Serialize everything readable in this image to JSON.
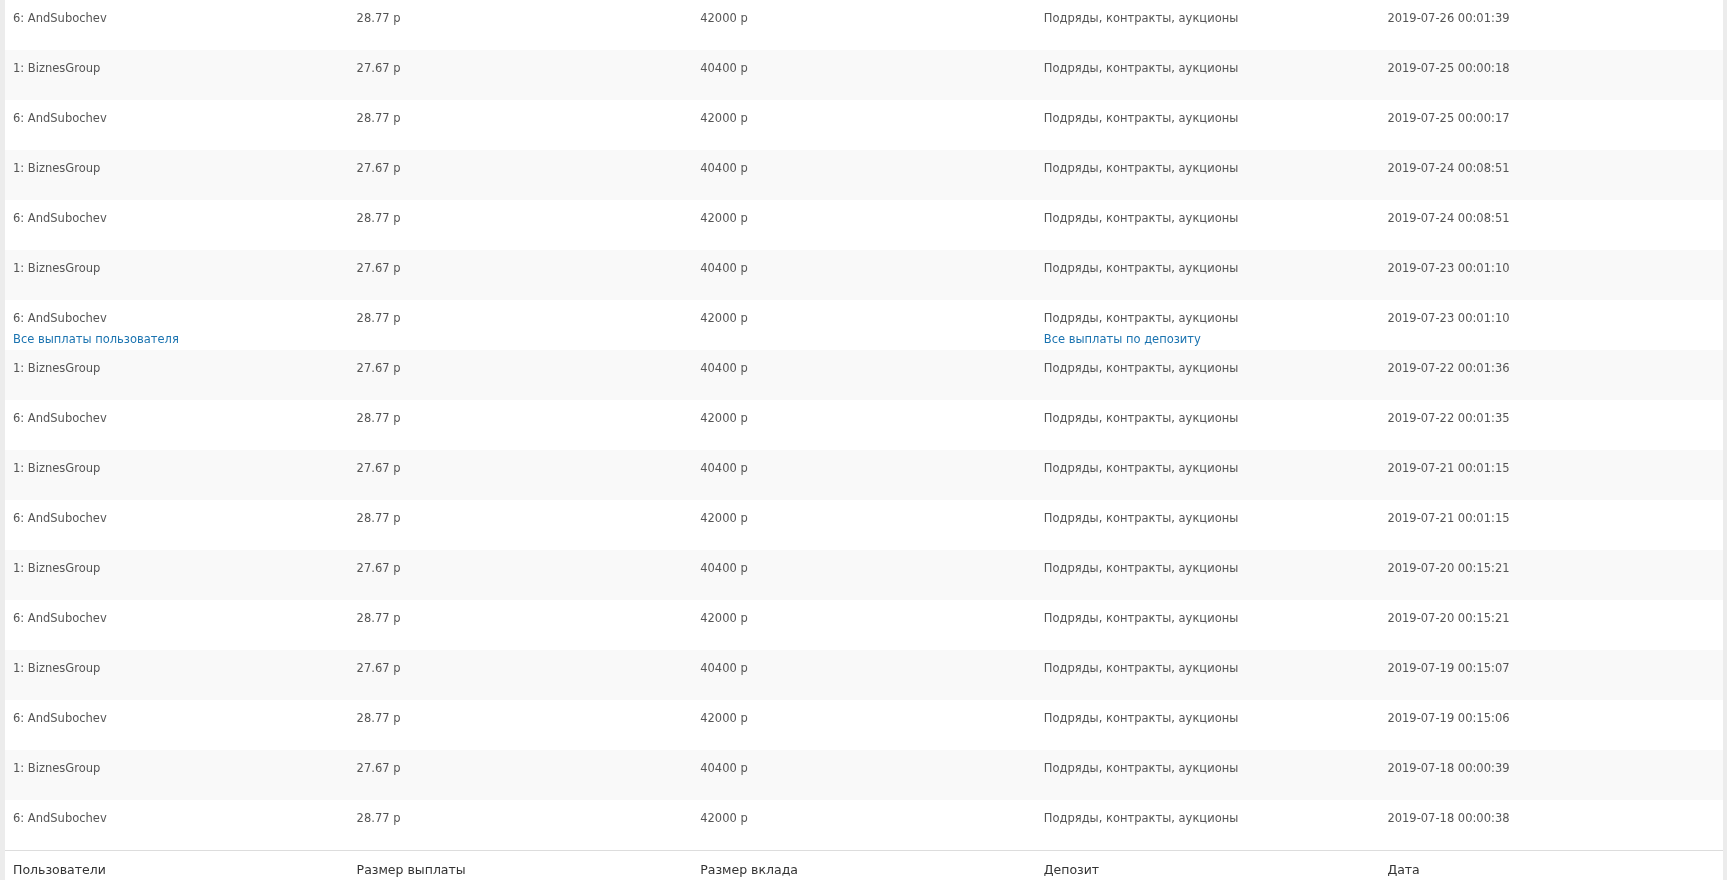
{
  "table": {
    "rows": [
      {
        "user": "6: AndSubochev",
        "payout": "28.77 р",
        "amount": "42000 р",
        "deposit": "Подряды, контракты, аукционы",
        "date": "2019-07-26 00:01:39"
      },
      {
        "user": "1: BiznesGroup",
        "payout": "27.67 р",
        "amount": "40400 р",
        "deposit": "Подряды, контракты, аукционы",
        "date": "2019-07-25 00:00:18"
      },
      {
        "user": "6: AndSubochev",
        "payout": "28.77 р",
        "amount": "42000 р",
        "deposit": "Подряды, контракты, аукционы",
        "date": "2019-07-25 00:00:17"
      },
      {
        "user": "1: BiznesGroup",
        "payout": "27.67 р",
        "amount": "40400 р",
        "deposit": "Подряды, контракты, аукционы",
        "date": "2019-07-24 00:08:51"
      },
      {
        "user": "6: AndSubochev",
        "payout": "28.77 р",
        "amount": "42000 р",
        "deposit": "Подряды, контракты, аукционы",
        "date": "2019-07-24 00:08:51"
      },
      {
        "user": "1: BiznesGroup",
        "payout": "27.67 р",
        "amount": "40400 р",
        "deposit": "Подряды, контракты, аукционы",
        "date": "2019-07-23 00:01:10"
      },
      {
        "user": "6: AndSubochev",
        "user_link": "Все выплаты пользователя",
        "payout": "28.77 р",
        "amount": "42000 р",
        "deposit": "Подряды, контракты, аукционы",
        "deposit_link": "Все выплаты по депозиту",
        "date": "2019-07-23 00:01:10"
      },
      {
        "user": "1: BiznesGroup",
        "payout": "27.67 р",
        "amount": "40400 р",
        "deposit": "Подряды, контракты, аукционы",
        "date": "2019-07-22 00:01:36"
      },
      {
        "user": "6: AndSubochev",
        "payout": "28.77 р",
        "amount": "42000 р",
        "deposit": "Подряды, контракты, аукционы",
        "date": "2019-07-22 00:01:35"
      },
      {
        "user": "1: BiznesGroup",
        "payout": "27.67 р",
        "amount": "40400 р",
        "deposit": "Подряды, контракты, аукционы",
        "date": "2019-07-21 00:01:15"
      },
      {
        "user": "6: AndSubochev",
        "payout": "28.77 р",
        "amount": "42000 р",
        "deposit": "Подряды, контракты, аукционы",
        "date": "2019-07-21 00:01:15"
      },
      {
        "user": "1: BiznesGroup",
        "payout": "27.67 р",
        "amount": "40400 р",
        "deposit": "Подряды, контракты, аукционы",
        "date": "2019-07-20 00:15:21"
      },
      {
        "user": "6: AndSubochev",
        "payout": "28.77 р",
        "amount": "42000 р",
        "deposit": "Подряды, контракты, аукционы",
        "date": "2019-07-20 00:15:21"
      },
      {
        "user": "1: BiznesGroup",
        "payout": "27.67 р",
        "amount": "40400 р",
        "deposit": "Подряды, контракты, аукционы",
        "date": "2019-07-19 00:15:07"
      },
      {
        "user": "6: AndSubochev",
        "payout": "28.77 р",
        "amount": "42000 р",
        "deposit": "Подряды, контракты, аукционы",
        "date": "2019-07-19 00:15:06"
      },
      {
        "user": "1: BiznesGroup",
        "payout": "27.67 р",
        "amount": "40400 р",
        "deposit": "Подряды, контракты, аукционы",
        "date": "2019-07-18 00:00:39"
      },
      {
        "user": "6: AndSubochev",
        "payout": "28.77 р",
        "amount": "42000 р",
        "deposit": "Подряды, контракты, аукционы",
        "date": "2019-07-18 00:00:38"
      }
    ],
    "footer": [
      "Пользователи",
      "Размер выплаты",
      "Размер вклада",
      "Депозит",
      "Дата"
    ]
  }
}
